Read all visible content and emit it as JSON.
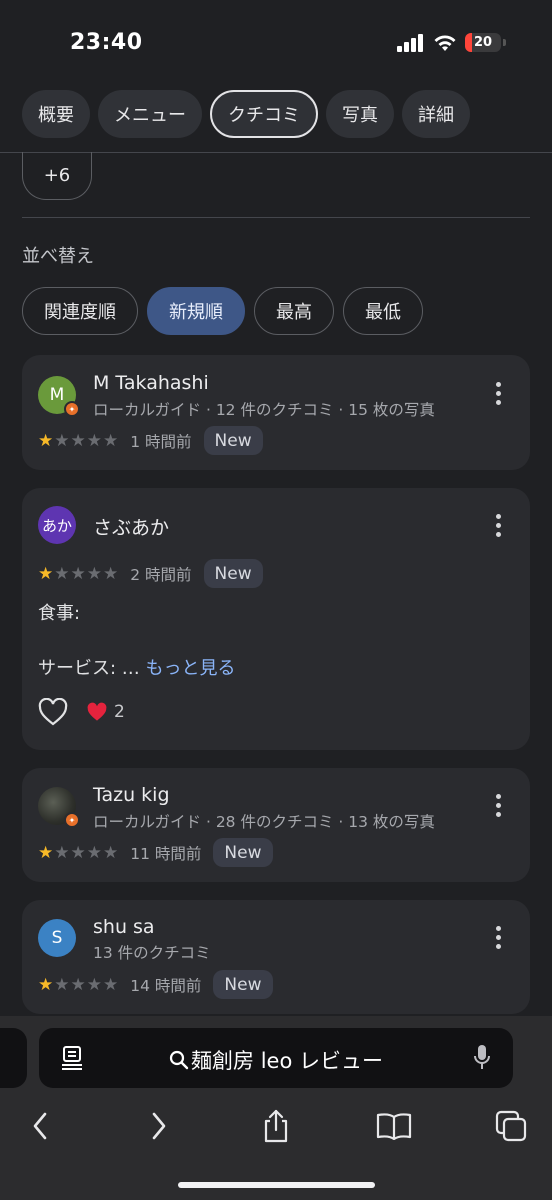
{
  "status_bar": {
    "time": "23:40",
    "battery_level": "20"
  },
  "tabs": [
    {
      "label": "概要"
    },
    {
      "label": "メニュー"
    },
    {
      "label": "クチコミ",
      "active": true
    },
    {
      "label": "写真"
    },
    {
      "label": "詳細"
    }
  ],
  "filter_more": "+6",
  "sort": {
    "label": "並べ替え",
    "options": [
      "関連度順",
      "新規順",
      "最高",
      "最低"
    ],
    "selected": "新規順"
  },
  "reviews": [
    {
      "avatar_text": "M",
      "avatar_color": "#6a9a3b",
      "name": "M Takahashi",
      "meta": "ローカルガイド · 12 件のクチコミ · 15 枚の写真",
      "rating": 1,
      "time": "1 時間前",
      "badge": "New"
    },
    {
      "avatar_text": "あか",
      "avatar_color": "#5e35b1",
      "name": "さぶあか",
      "rating": 1,
      "time": "2 時間前",
      "badge": "New",
      "text_line1": "食事:",
      "text_line2": "サービス: … ",
      "more_link": "もっと見る",
      "reaction_count": "2"
    },
    {
      "avatar_text": "",
      "name": "Tazu kig",
      "meta": "ローカルガイド · 28 件のクチコミ · 13 枚の写真",
      "rating": 1,
      "time": "11 時間前",
      "badge": "New"
    },
    {
      "avatar_text": "S",
      "avatar_color": "#3b82c4",
      "name": "shu sa",
      "meta": "13 件のクチコミ",
      "rating": 1,
      "time": "14 時間前",
      "badge": "New"
    }
  ],
  "browser": {
    "address_text": "麺創房 leo レビュー"
  },
  "colors": {
    "background": "#1f2023",
    "card": "#2a2b2f",
    "selected_chip": "#3e5787",
    "star": "#f7b928",
    "link": "#8ab4f8",
    "battery_low": "#ff453a"
  }
}
